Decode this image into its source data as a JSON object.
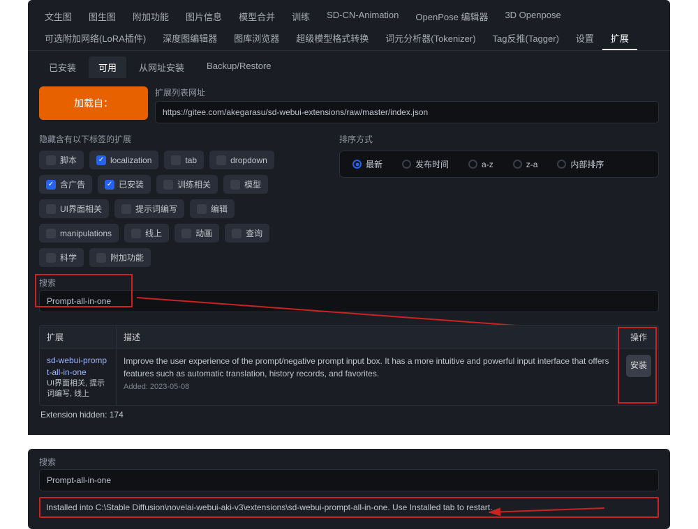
{
  "main_tabs": {
    "row1": [
      "文生图",
      "图生图",
      "附加功能",
      "图片信息",
      "模型合并",
      "训练",
      "SD-CN-Animation",
      "OpenPose 编辑器",
      "3D Openpose"
    ],
    "row2": [
      "可选附加网络(LoRA插件)",
      "深度图编辑器",
      "图库浏览器",
      "超级模型格式转换",
      "词元分析器(Tokenizer)",
      "Tag反推(Tagger)",
      "设置",
      "扩展"
    ],
    "active": "扩展"
  },
  "sub_tabs": {
    "items": [
      "已安装",
      "可用",
      "从网址安装",
      "Backup/Restore"
    ],
    "active": "可用"
  },
  "load_button": "加载自：",
  "url_field": {
    "label": "扩展列表网址",
    "value": "https://gitee.com/akegarasu/sd-webui-extensions/raw/master/index.json"
  },
  "filters": {
    "label": "隐藏含有以下标签的扩展",
    "items": [
      {
        "label": "脚本",
        "on": false
      },
      {
        "label": "localization",
        "on": true
      },
      {
        "label": "tab",
        "on": false
      },
      {
        "label": "dropdown",
        "on": false
      },
      {
        "label": "含广告",
        "on": true
      },
      {
        "label": "已安装",
        "on": true
      },
      {
        "label": "训练相关",
        "on": false
      },
      {
        "label": "模型",
        "on": false
      },
      {
        "label": "UI界面相关",
        "on": false
      },
      {
        "label": "提示词编写",
        "on": false
      },
      {
        "label": "编辑",
        "on": false
      },
      {
        "label": "manipulations",
        "on": false
      },
      {
        "label": "线上",
        "on": false
      },
      {
        "label": "动画",
        "on": false
      },
      {
        "label": "查询",
        "on": false
      },
      {
        "label": "科学",
        "on": false
      },
      {
        "label": "附加功能",
        "on": false
      }
    ]
  },
  "sort": {
    "label": "排序方式",
    "items": [
      {
        "label": "最新",
        "on": true
      },
      {
        "label": "发布时间",
        "on": false
      },
      {
        "label": "a-z",
        "on": false
      },
      {
        "label": "z-a",
        "on": false
      },
      {
        "label": "内部排序",
        "on": false
      }
    ]
  },
  "search": {
    "label": "搜索",
    "value": "Prompt-all-in-one"
  },
  "table": {
    "headers": {
      "ext": "扩展",
      "desc": "描述",
      "act": "操作"
    },
    "row": {
      "name": "sd-webui-prompt-all-in-one",
      "tags": "UI界面相关, 提示词编写, 线上",
      "desc": "Improve the user experience of the prompt/negative prompt input box. It has a more intuitive and powerful input interface that offers features such as automatic translation, history records, and favorites.",
      "added": "Added: 2023-05-08",
      "install": "安装"
    }
  },
  "hidden_count": "Extension hidden: 174",
  "bottom": {
    "search_label": "搜索",
    "search_value": "Prompt-all-in-one",
    "msg": "Installed into C:\\Stable Diffusion\\novelai-webui-aki-v3\\extensions\\sd-webui-prompt-all-in-one. Use Installed tab to restart."
  }
}
